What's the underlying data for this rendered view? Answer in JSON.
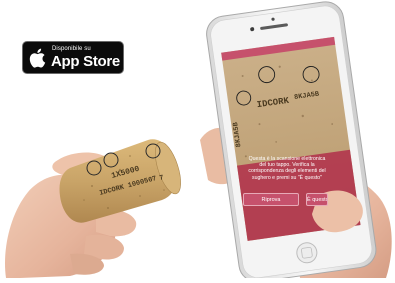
{
  "badge": {
    "small_text": "Disponibile su",
    "store_name": "App Store",
    "icon": "apple-icon"
  },
  "cork_left": {
    "code_line_1": "1X5000",
    "code_line_2": "IDCORK 1000567",
    "code_line_3": "7"
  },
  "phone_screen": {
    "cork_code_a": "IDCORK",
    "cork_code_b": "8KJA5B",
    "cork_code_side": "8KJA5B",
    "message": "Questa è la scansione elettronica del tuo tappo. Verifica la corrispondenza degli elementi del sughero e premi su \"È questo\"",
    "retry_label": "Riprova",
    "ok_label": "È questo"
  },
  "colors": {
    "accent_pink": "#c6516c",
    "overlay_red": "#b2384f",
    "badge_bg": "#0b0b0b",
    "cork": "#c9a468"
  }
}
